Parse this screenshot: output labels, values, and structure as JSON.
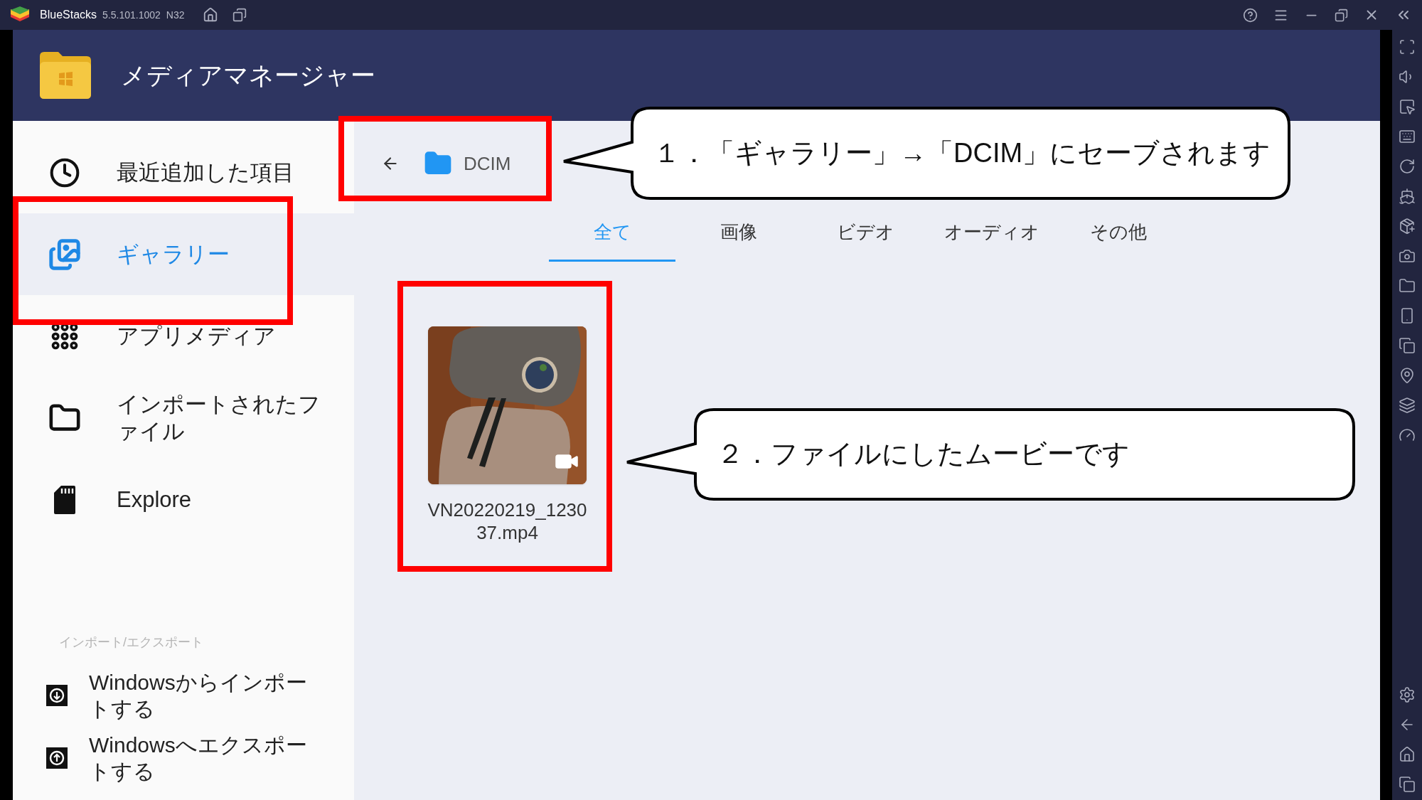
{
  "window": {
    "app_name": "BlueStacks",
    "version": "5.5.101.1002",
    "build": "N32"
  },
  "header": {
    "title": "メディアマネージャー"
  },
  "sidebar": {
    "items": [
      {
        "label": "最近追加した項目",
        "kind": "clock",
        "selected": false
      },
      {
        "label": "ギャラリー",
        "kind": "gallery",
        "selected": true
      },
      {
        "label": "アプリメディア",
        "kind": "grid",
        "selected": false
      },
      {
        "label": "インポートされたファイル",
        "kind": "folder",
        "selected": false
      },
      {
        "label": "Explore",
        "kind": "sdcard",
        "selected": false
      }
    ],
    "section_label": "インポート/エクスポート",
    "actions": [
      {
        "label": "Windowsからインポートする",
        "kind": "import"
      },
      {
        "label": "Windowsへエクスポートする",
        "kind": "export"
      }
    ]
  },
  "breadcrumb": {
    "folder": "DCIM"
  },
  "tabs": [
    {
      "label": "全て",
      "selected": true
    },
    {
      "label": "画像",
      "selected": false
    },
    {
      "label": "ビデオ",
      "selected": false
    },
    {
      "label": "オーディオ",
      "selected": false
    },
    {
      "label": "その他",
      "selected": false
    }
  ],
  "files": [
    {
      "name": "VN20220219_123037.mp4",
      "kind": "video"
    }
  ],
  "annotations": [
    {
      "text": "１．「ギャラリー」→「DCIM」にセーブされます"
    },
    {
      "text": "２．ファイルにしたムービーです"
    }
  ]
}
